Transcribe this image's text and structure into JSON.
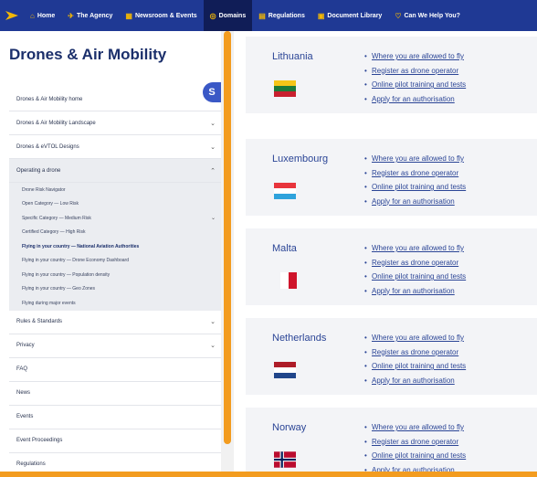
{
  "nav": {
    "items": [
      {
        "icon": "home-icon",
        "glyph": "⌂",
        "label": "Home",
        "active": false
      },
      {
        "icon": "agency-icon",
        "glyph": "✈",
        "label": "The Agency",
        "active": false
      },
      {
        "icon": "newsroom-icon",
        "glyph": "▦",
        "label": "Newsroom & Events",
        "active": false
      },
      {
        "icon": "domains-icon",
        "glyph": "◎",
        "label": "Domains",
        "active": true
      },
      {
        "icon": "regulations-icon",
        "glyph": "▤",
        "label": "Regulations",
        "active": false
      },
      {
        "icon": "document-library-icon",
        "glyph": "▣",
        "label": "Document Library",
        "active": false
      },
      {
        "icon": "help-icon",
        "glyph": "♡",
        "label": "Can We Help You?",
        "active": false
      }
    ]
  },
  "sidebar": {
    "title": "Drones & Air Mobility",
    "badge": "S",
    "items": [
      {
        "label": "Drones & Air Mobility home",
        "chevron": ""
      },
      {
        "label": "Drones & Air Mobility Landscape",
        "chevron": "⌄"
      },
      {
        "label": "Drones & eVTOL Designs",
        "chevron": "⌄"
      },
      {
        "label": "Operating a drone",
        "chevron": "⌃"
      }
    ],
    "subitems": [
      {
        "label": "Drone Risk Navigator",
        "chevron": ""
      },
      {
        "label": "Open Category — Low Risk",
        "chevron": ""
      },
      {
        "label": "Specific Category — Medium Risk",
        "chevron": "⌄"
      },
      {
        "label": "Certified Category — High Risk",
        "chevron": ""
      },
      {
        "label": "Flying in your country — National Aviation Authorities",
        "chevron": ""
      },
      {
        "label": "Flying in your country — Drone Economy Dashboard",
        "chevron": ""
      },
      {
        "label": "Flying in your country — Population density",
        "chevron": ""
      },
      {
        "label": "Flying in your country — Geo Zones",
        "chevron": ""
      },
      {
        "label": "Flying during major events",
        "chevron": ""
      }
    ],
    "current_subitem": "Flying in your country — National Aviation Authorities",
    "lower_items": [
      {
        "label": "Rules & Standards",
        "chevron": "⌄"
      },
      {
        "label": "Privacy",
        "chevron": "⌄"
      },
      {
        "label": "FAQ",
        "chevron": ""
      },
      {
        "label": "News",
        "chevron": ""
      },
      {
        "label": "Events",
        "chevron": ""
      },
      {
        "label": "Event Proceedings",
        "chevron": ""
      },
      {
        "label": "Regulations",
        "chevron": ""
      }
    ]
  },
  "countries": [
    {
      "name": "Lithuania",
      "flag": [
        "#f5c518",
        "#1d7a3a",
        "#c8202f"
      ],
      "links": [
        "Where you are allowed to fly",
        "Register as drone operator",
        "Online pilot training and tests",
        "Apply for an authorisation"
      ]
    },
    {
      "name": "Luxembourg",
      "flag": [
        "#e8343c",
        "#ffffff",
        "#2fa3dc"
      ],
      "links": [
        "Where you are allowed to fly",
        "Register as drone operator",
        "Online pilot training and tests",
        "Apply for an authorisation"
      ]
    },
    {
      "name": "Malta",
      "flag": [
        "#ffffff",
        "#cf142b"
      ],
      "links": [
        "Where you are allowed to fly",
        "Register as drone operator",
        "Online pilot training and tests",
        "Apply for an authorisation"
      ]
    },
    {
      "name": "Netherlands",
      "flag": [
        "#ae1c28",
        "#ffffff",
        "#21468b"
      ],
      "links": [
        "Where you are allowed to fly",
        "Register as drone operator",
        "Online pilot training and tests",
        "Apply for an authorisation"
      ]
    },
    {
      "name": "Norway",
      "flag": [
        "#ba0c2f",
        "#ffffff",
        "#00205b"
      ],
      "links": [
        "Where you are allowed to fly",
        "Register as drone operator",
        "Online pilot training and tests",
        "Apply for an authorisation"
      ]
    }
  ],
  "colors": {
    "nav_bg": "#1f3994",
    "nav_active": "#101d57",
    "accent": "#f39c1f",
    "link": "#2b4596"
  }
}
